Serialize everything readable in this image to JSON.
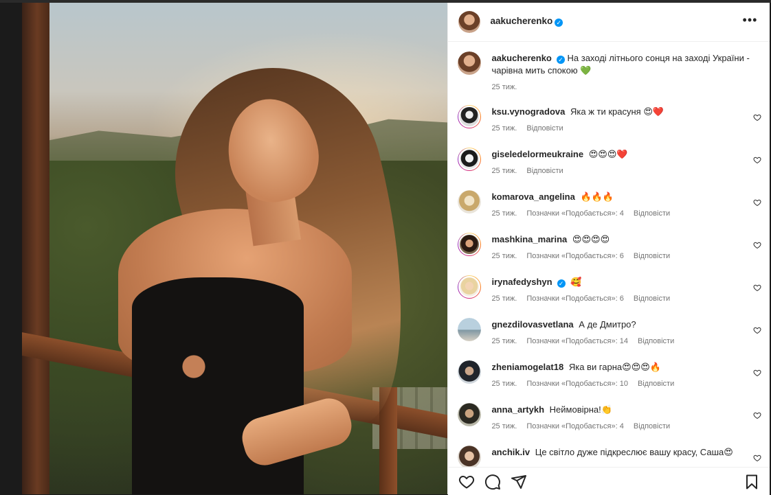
{
  "post": {
    "author": {
      "username": "aakucherenko",
      "verified": true
    },
    "caption": {
      "username": "aakucherenko",
      "text": "На заході літнього сонця на заході України - чарівна мить спокою 💚",
      "time": "25 тиж."
    }
  },
  "labels": {
    "reply": "Відповісти"
  },
  "comments": [
    {
      "username": "ksu.vynogradova",
      "text": "Яка ж ти красуня 😍❤️",
      "time": "25 тиж.",
      "likes": "",
      "reply": "Відповісти"
    },
    {
      "username": "giseledelormeukraine",
      "text": "😍😍😍❤️",
      "time": "25 тиж.",
      "likes": "",
      "reply": "Відповісти"
    },
    {
      "username": "komarova_angelina",
      "text": "🔥🔥🔥",
      "time": "25 тиж.",
      "likes": "Позначки «Подобається»: 4",
      "reply": "Відповісти"
    },
    {
      "username": "mashkina_marina",
      "text": "😍😍😍😍",
      "time": "25 тиж.",
      "likes": "Позначки «Подобається»: 6",
      "reply": "Відповісти"
    },
    {
      "username": "irynafedyshyn",
      "verified": true,
      "text": "🥰",
      "time": "25 тиж.",
      "likes": "Позначки «Подобається»: 6",
      "reply": "Відповісти"
    },
    {
      "username": "gnezdilovasvetlana",
      "text": "А де Дмитро?",
      "time": "25 тиж.",
      "likes": "Позначки «Подобається»: 14",
      "reply": "Відповісти"
    },
    {
      "username": "zheniamogelat18",
      "text": "Яка ви гарна😍😍😍🔥",
      "time": "25 тиж.",
      "likes": "Позначки «Подобається»: 10",
      "reply": "Відповісти"
    },
    {
      "username": "anna_artykh",
      "text": "Неймовірна!👏",
      "time": "25 тиж.",
      "likes": "Позначки «Подобається»: 4",
      "reply": "Відповісти"
    },
    {
      "username": "anchik.iv",
      "text": "Це світло дуже підкреслює вашу красу, Саша😍",
      "time": "",
      "likes": "",
      "reply": ""
    }
  ],
  "colors": {
    "verified": "#0095f6",
    "text": "#262626",
    "secondary": "#737373"
  },
  "icons": {
    "more": "more-options-icon",
    "like": "heart-icon",
    "comment": "comment-bubble-icon",
    "share": "send-icon",
    "save": "bookmark-icon"
  }
}
